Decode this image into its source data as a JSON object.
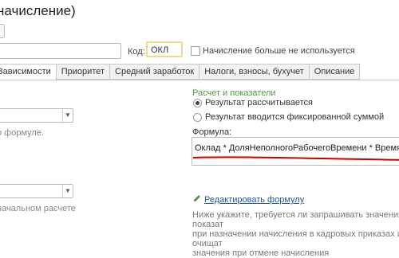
{
  "window": {
    "title": "начисление)"
  },
  "form": {
    "code_label": "Код:",
    "code_value": "ОКЛ",
    "checkbox_label": "Начисление больше не используется"
  },
  "tabs": [
    {
      "label": "Зависимости",
      "active": true
    },
    {
      "label": "Приоритет",
      "active": false
    },
    {
      "label": "Средний заработок",
      "active": false
    },
    {
      "label": "Налоги, взносы, бухучет",
      "active": false
    },
    {
      "label": "Описание",
      "active": false
    }
  ],
  "left": {
    "hint1": "о формуле.",
    "hint2": "начальном расчете"
  },
  "right": {
    "section_title": "Расчет и показатели",
    "radio1": "Результат рассчитывается",
    "radio2": "Результат вводится фиксированной суммой",
    "formula_label": "Формула:",
    "formula_text": "Оклад * ДоляНеполногоРабочегоВремени * ВремяВДнях / НормаДнейПоГрафику",
    "edit_link": "Редактировать формулу",
    "hint_line1": "Ниже укажите, требуется ли запрашивать значения показат",
    "hint_line2": "при назначении начисления в кадровых приказах и очищат",
    "hint_line3": "значения при отмене начисления"
  },
  "colors": {
    "accent_green": "#4f9a3f",
    "link_blue": "#2255aa",
    "highlight_red": "#cc0000",
    "code_border": "#f0d98a"
  }
}
